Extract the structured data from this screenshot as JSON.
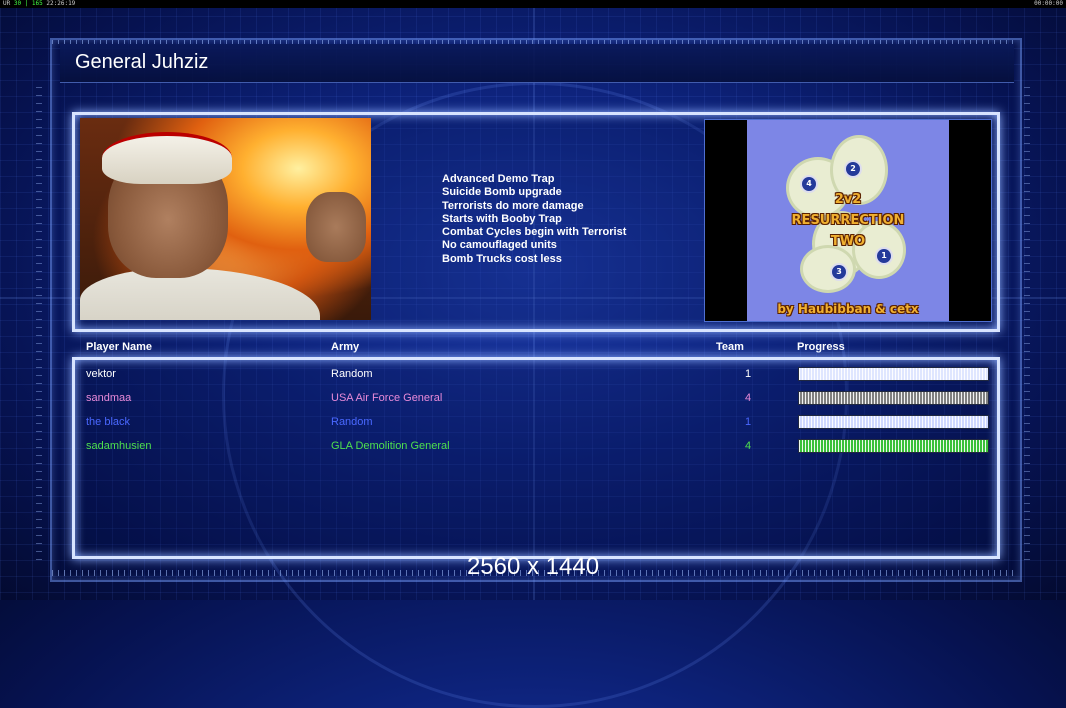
{
  "status_bar": {
    "left_prefix": "UR",
    "left_values": "30 | 165",
    "left_time": "22:26:19",
    "right_time": "00:00:00"
  },
  "screen": {
    "title": "General Juhziz"
  },
  "general": {
    "bonuses": [
      "Advanced Demo Trap",
      "Suicide Bomb upgrade",
      "Terrorists do more damage",
      "Starts with Booby Trap",
      "Combat Cycles begin with Terrorist",
      "No camouflaged units",
      "Bomb Trucks cost less"
    ]
  },
  "map": {
    "title_lines": [
      "2v2",
      "RESURRECTION",
      "TWO"
    ],
    "credit": "by Haubibban & cetx",
    "start_positions": [
      "1",
      "2",
      "3",
      "4"
    ]
  },
  "table": {
    "headers": {
      "player": "Player Name",
      "army": "Army",
      "team": "Team",
      "progress": "Progress"
    },
    "rows": [
      {
        "name": "vektor",
        "army": "Random",
        "team": "1",
        "color": "#ffffff",
        "bar_color": "#dfe6ff",
        "progress": 1.0
      },
      {
        "name": "sandmaa",
        "army": "USA Air Force General",
        "team": "4",
        "color": "#e88ad8",
        "bar_color": "#808080",
        "progress": 1.0
      },
      {
        "name": "the black",
        "army": "Random",
        "team": "1",
        "color": "#4a68ff",
        "bar_color": "#cfd8ff",
        "progress": 1.0
      },
      {
        "name": "sadamhusien",
        "army": "GLA Demolition General",
        "team": "4",
        "color": "#4ee04e",
        "bar_color": "#39c039",
        "progress": 1.0
      }
    ]
  },
  "resolution_label": "2560 x 1440"
}
